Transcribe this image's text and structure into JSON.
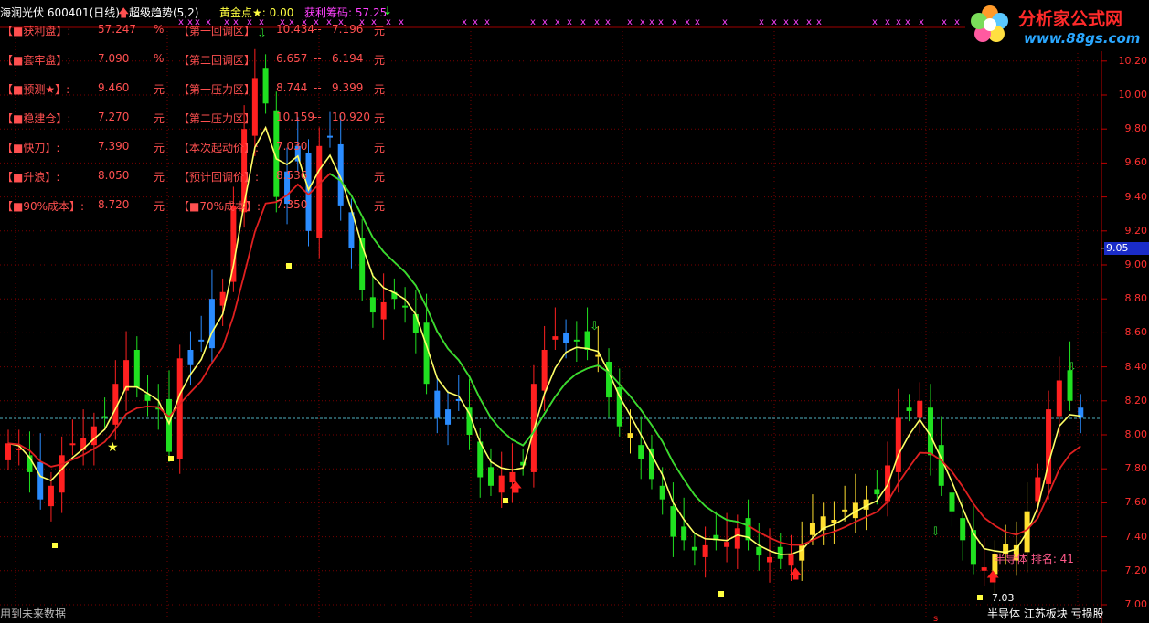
{
  "header": {
    "stock": "海润光伏 600401(日线)",
    "arrow_icon": "red-up-arrow-icon",
    "indicator": "超级趋势(5,2)",
    "gold_label": "黄金点★: 0.00",
    "profit_label": "获利筹码: 57.25",
    "profit_arrow": "↓"
  },
  "info_left": [
    {
      "label": "【■获利盘】:",
      "value": "57.247",
      "unit": "%"
    },
    {
      "label": "【■套牢盘】:",
      "value": "7.090",
      "unit": "%"
    },
    {
      "label": "【■预测★】:",
      "value": "9.460",
      "unit": "元"
    },
    {
      "label": "【■稳建仓】:",
      "value": "7.270",
      "unit": "元"
    },
    {
      "label": "【■快刀】:",
      "value": "7.390",
      "unit": "元"
    },
    {
      "label": "【■升浪】:",
      "value": "8.050",
      "unit": "元"
    },
    {
      "label": "【■90%成本】:",
      "value": "8.720",
      "unit": "元"
    }
  ],
  "info_right": [
    {
      "label": "【第一回调区】",
      "v1": "10.434",
      "sep": "--",
      "v2": "7.196",
      "unit": "元"
    },
    {
      "label": "【第二回调区】",
      "v1": "6.657",
      "sep": "--",
      "v2": "6.194",
      "unit": "元"
    },
    {
      "label": "【第一压力区】",
      "v1": "8.744",
      "sep": "--",
      "v2": "9.399",
      "unit": "元"
    },
    {
      "label": "【第二压力区】",
      "v1": "10.159",
      "sep": "--",
      "v2": "10.920",
      "unit": "元"
    },
    {
      "label": "【本次起动价】:",
      "v1": "7.030",
      "sep": "",
      "v2": "",
      "unit": "元"
    },
    {
      "label": "【预计回调价】:",
      "v1": "8.536",
      "sep": "",
      "v2": "",
      "unit": "元"
    },
    {
      "label": "【■70%成本】:",
      "v1": "7.350",
      "sep": "",
      "v2": "",
      "unit": "元"
    }
  ],
  "axis_labels": [
    "10.20",
    "10.00",
    "9.80",
    "9.60",
    "9.40",
    "9.20",
    "9.00",
    "8.80",
    "8.60",
    "8.40",
    "8.20",
    "8.00",
    "7.80",
    "7.60",
    "7.40",
    "7.20",
    "7.00"
  ],
  "current_price": "9.05",
  "logo": {
    "title": "分析家公式网",
    "url": "www.88gs.com",
    "icon": "flower-logo-icon"
  },
  "footer_left": "用到未来数据",
  "footer_right": "半导体 江苏板块 亏损股",
  "rank_text": "半导体 排名: 41",
  "low_label": "7.03",
  "colors": {
    "bg": "#000000",
    "up": "#ff2020",
    "down": "#20e020",
    "blue": "#2a8cff",
    "yellowc": "#ffe030",
    "grid": "#8a0000"
  }
}
